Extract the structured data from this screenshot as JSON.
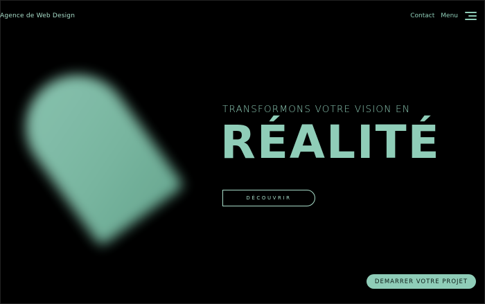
{
  "header": {
    "brand": "Agence de Web Design",
    "nav": {
      "contact": "Contact",
      "menu": "Menu",
      "menu_icon": "hamburger-icon"
    }
  },
  "hero": {
    "subtitle": "TRANSFORMONS VOTRE VISION EN",
    "title": "RÉALITÉ",
    "discover_button": "DÉCOUVRIR"
  },
  "cta": {
    "start_project": "DEMARRER VOTRE PROJET"
  },
  "colors": {
    "background": "#000000",
    "accent": "#8fcdb8"
  }
}
